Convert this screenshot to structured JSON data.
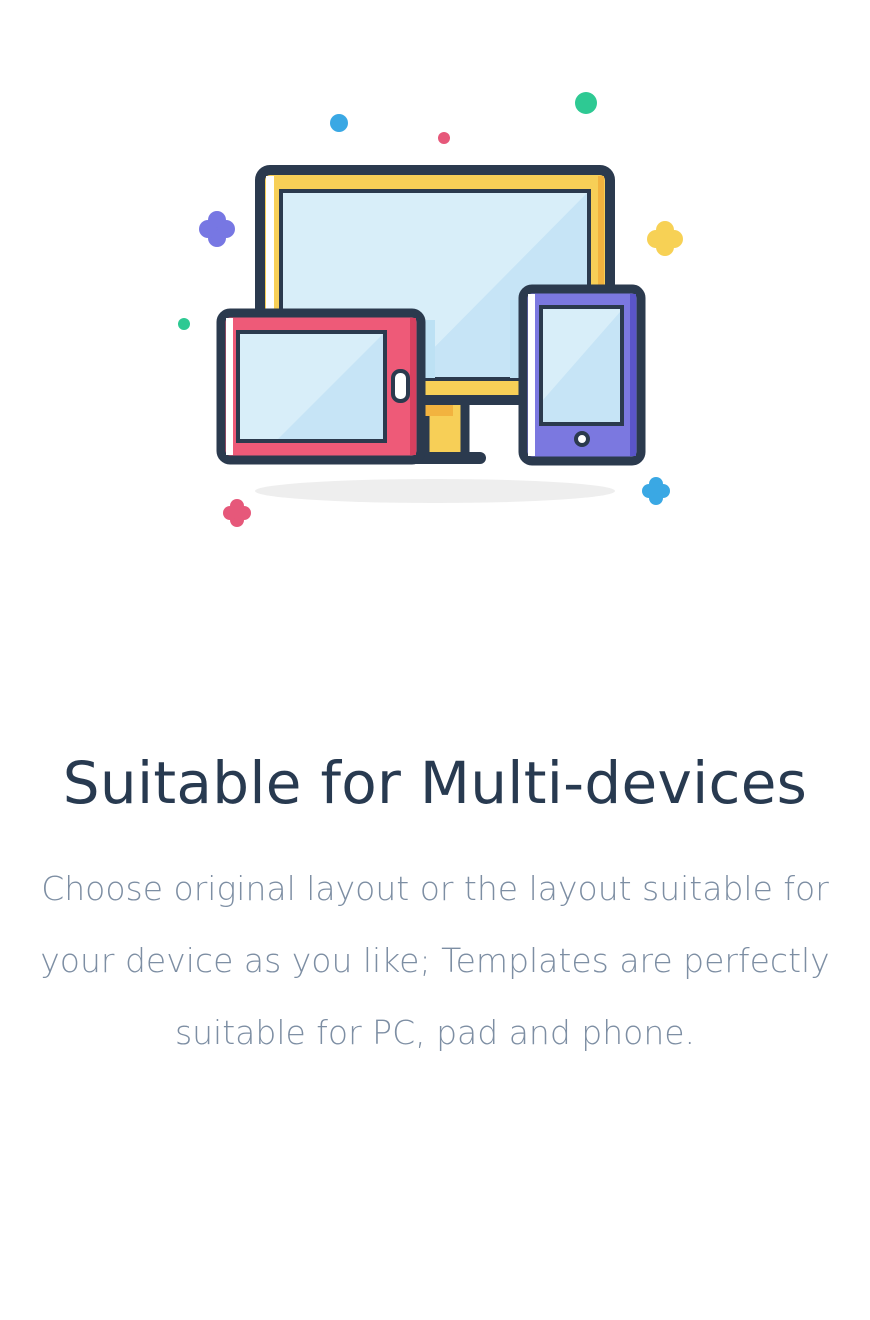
{
  "feature": {
    "title": "Suitable for Multi-devices",
    "description": "Choose original layout or the layout suitable for your device as you like; Templates are perfectly suitable for PC, pad and phone."
  },
  "illustration": {
    "icon": "multi-device-icon",
    "devices": [
      "monitor-icon",
      "tablet-icon",
      "phone-icon"
    ],
    "colors": {
      "outline": "#2b3a4e",
      "monitor": "#f7cf57",
      "tablet": "#ee5a78",
      "phone": "#7b78e0",
      "screen": "#cfe7f6",
      "shadow": "#eeeeee",
      "dot_blue": "#3aa8e4",
      "dot_green": "#2ec993",
      "dot_pink": "#e6587a",
      "dot_purple": "#7777e3",
      "dot_yellow": "#f7d155"
    }
  }
}
